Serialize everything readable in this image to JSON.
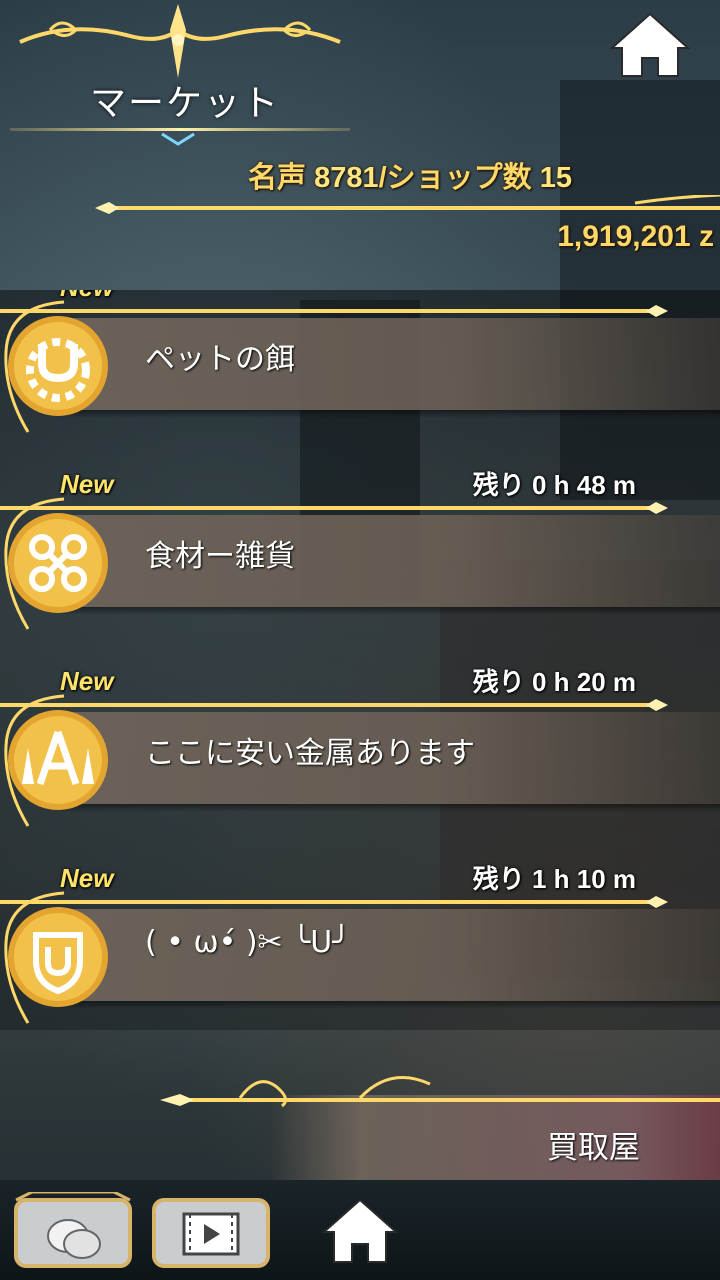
{
  "header": {
    "title": "マーケット",
    "fame_label": "名声",
    "fame_value": "8781",
    "shop_label": "/ショップ数",
    "shop_count": "15",
    "money": "1,919,201 z"
  },
  "shops": [
    {
      "new_label": "New",
      "timer": "",
      "name": "ペットの餌",
      "icon": "horseshoe-gear-icon"
    },
    {
      "new_label": "New",
      "timer": "残り 0 h 48 m",
      "name": "食材ー雑貨",
      "icon": "ornament-knot-icon"
    },
    {
      "new_label": "New",
      "timer": "残り 0 h 20 m",
      "name": "ここに安い金属あります",
      "icon": "anvil-crest-icon"
    },
    {
      "new_label": "New",
      "timer": "残り 1 h 10 m",
      "name": "( • ω•́ )✂ ╰U╯",
      "icon": "shield-horseshoe-icon"
    }
  ],
  "buyer": {
    "label": "買取屋"
  },
  "nav": {
    "coins_icon": "coins-icon",
    "video_icon": "video-icon",
    "home_icon": "home-icon"
  },
  "colors": {
    "gold": "#ffd86a",
    "panel": "#6e645a",
    "new": "#ffe36a"
  }
}
